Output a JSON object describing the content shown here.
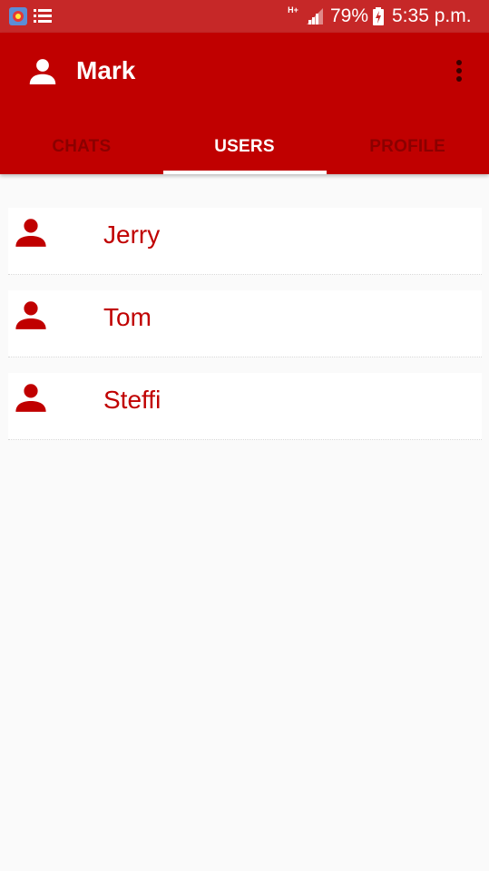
{
  "status_bar": {
    "network_label": "H+",
    "battery_percent": "79%",
    "time": "5:35 p.m.",
    "icons": [
      "app-notification-icon",
      "list-icon",
      "signal-icon",
      "battery-charging-icon"
    ]
  },
  "app_bar": {
    "title": "Mark",
    "avatar_icon": "person-icon",
    "menu_icon": "more-vert-icon"
  },
  "tabs": [
    {
      "label": "CHATS",
      "active": false
    },
    {
      "label": "USERS",
      "active": true
    },
    {
      "label": "PROFILE",
      "active": false
    }
  ],
  "users": [
    {
      "name": "Jerry",
      "icon": "person-icon"
    },
    {
      "name": "Tom",
      "icon": "person-icon"
    },
    {
      "name": "Steffi",
      "icon": "person-icon"
    }
  ],
  "colors": {
    "status_bar": "#c62828",
    "app_bar": "#c00000",
    "inactive_tab": "#8b0000",
    "active_tab": "#ffffff",
    "user_name": "#c00000",
    "background": "#fafafa"
  }
}
